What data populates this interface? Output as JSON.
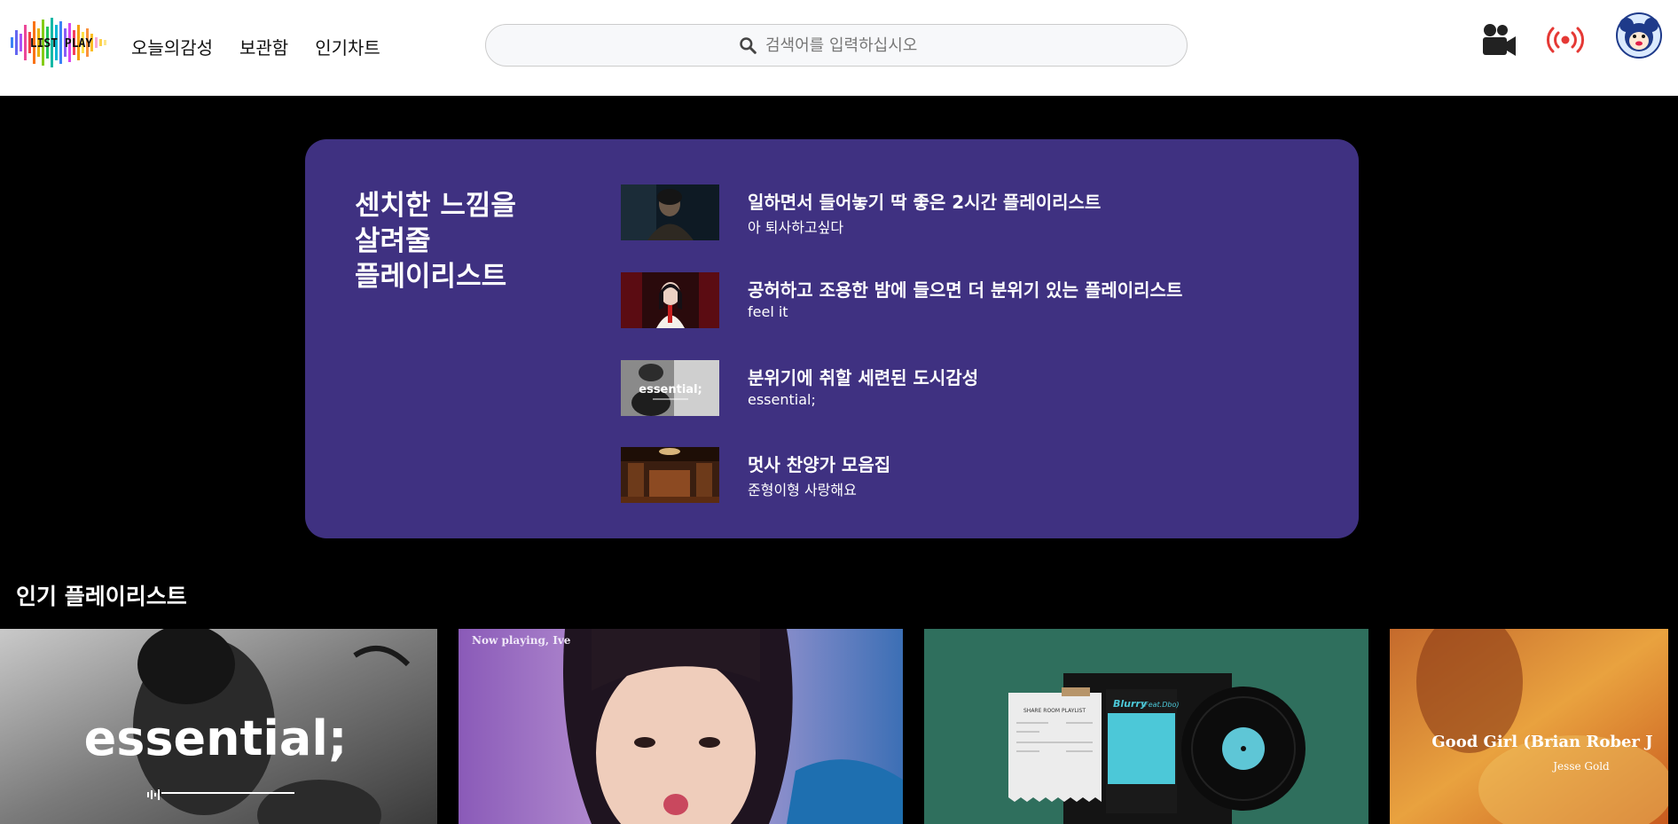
{
  "header": {
    "logo_text": "LIST PLAY",
    "nav": [
      "오늘의감성",
      "보관함",
      "인기차트"
    ],
    "search_placeholder": "검색어를 입력하십시오",
    "icons": [
      "video-camera-icon",
      "broadcast-icon",
      "profile-avatar"
    ]
  },
  "hero": {
    "title_lines": [
      "센치한 느낌을",
      "살려줄",
      "플레이리스트"
    ],
    "items": [
      {
        "title": "일하면서 들어놓기 딱 좋은 2시간 플레이리스트",
        "subtitle": "아 퇴사하고싶다"
      },
      {
        "title": "공허하고 조용한 밤에 들으면 더 분위기 있는 플레이리스트",
        "subtitle": "feel it"
      },
      {
        "title": "분위기에 취할 세련된 도시감성",
        "subtitle": "essential;",
        "thumb_text": "essential;"
      },
      {
        "title": "멋사 찬양가 모음집",
        "subtitle": "준형이형 사랑해요"
      }
    ]
  },
  "popular": {
    "title": "인기 플레이리스트",
    "cards": [
      {
        "text": "essential;"
      },
      {
        "text": "Now playing, Ive"
      },
      {
        "text_a": "SHARE ROOM PLAYLIST",
        "text_b": "Blurry",
        "text_c": "(Feat.Dbo)"
      },
      {
        "text_a": "Good Girl (Brian Rober J",
        "text_b": "Jesse Gold"
      }
    ]
  },
  "colors": {
    "hero_bg": "#3f3181",
    "page_bg": "#000000",
    "header_bg": "#ffffff"
  }
}
